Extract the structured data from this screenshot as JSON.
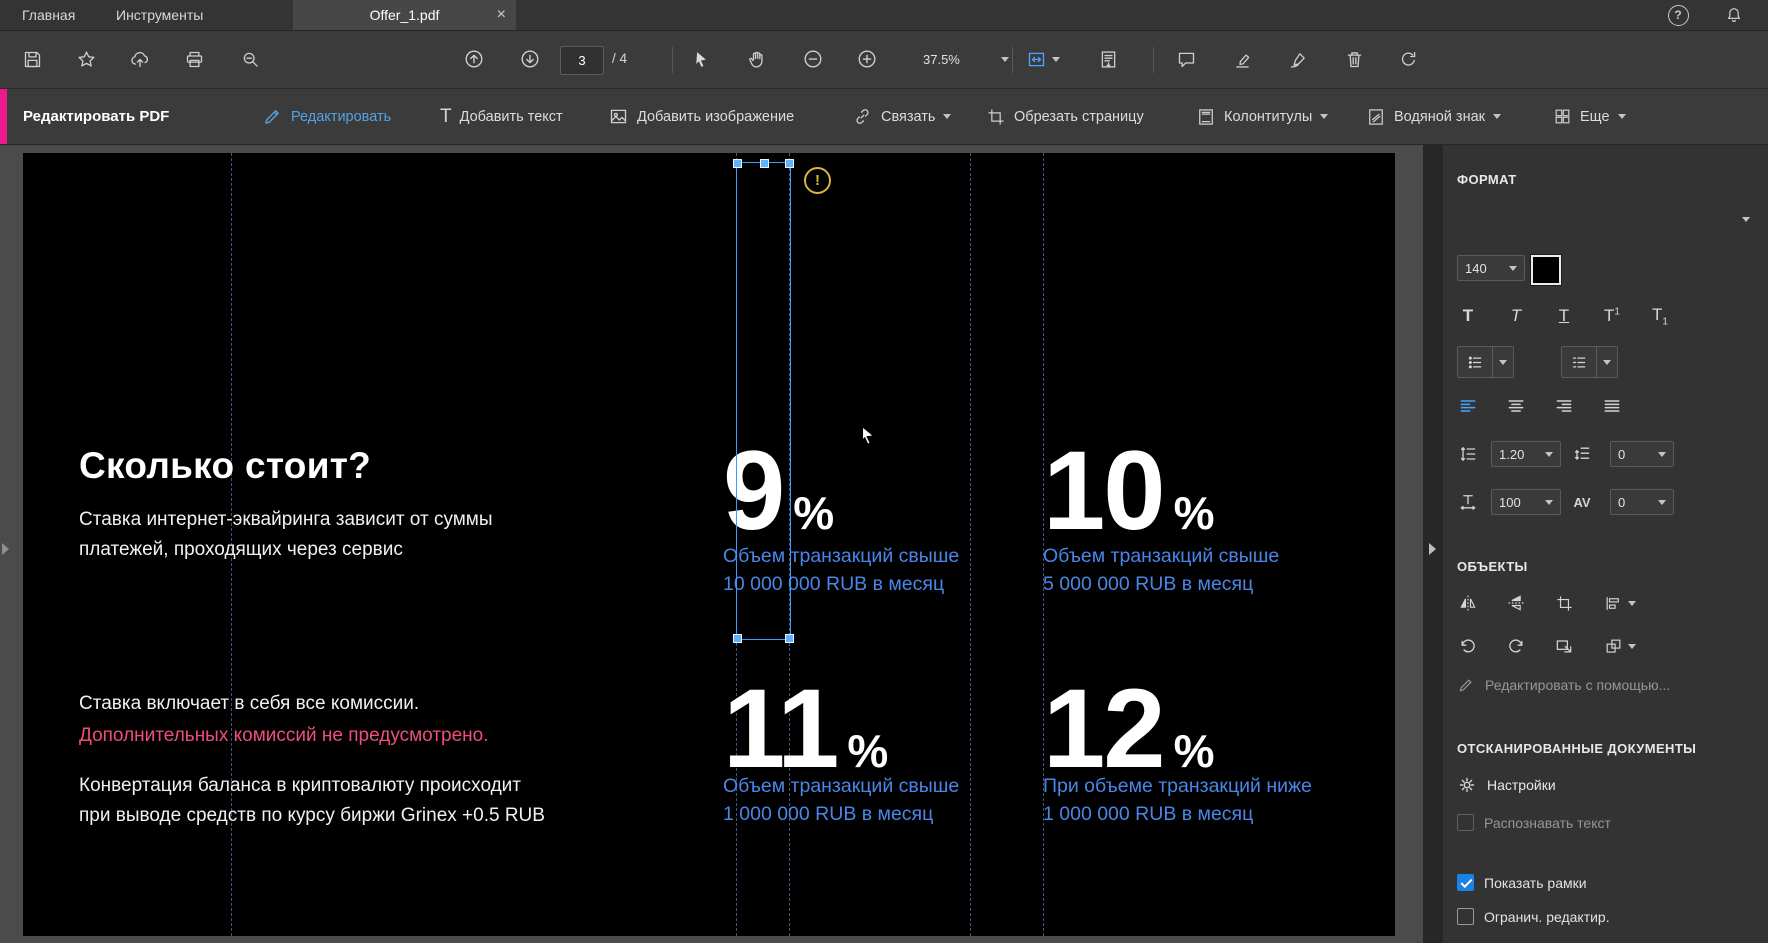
{
  "titlebar": {
    "home_tab": "Главная",
    "tools_tab": "Инструменты",
    "document_tab": "Offer_1.pdf",
    "close_glyph": "×",
    "help_glyph": "?"
  },
  "toolbar": {
    "page_current": "3",
    "page_total": "/ 4",
    "zoom_value": "37.5%"
  },
  "editbar": {
    "title": "Редактировать PDF",
    "edit": "Редактировать",
    "text_tool_glyph": "T",
    "add_text": "Добавить текст",
    "add_image": "Добавить изображение",
    "link": "Связать",
    "crop": "Обрезать страницу",
    "header_footer": "Колонтитулы",
    "watermark": "Водяной знак",
    "more": "Еще"
  },
  "pdf": {
    "heading": "Сколько стоит?",
    "intro_line1": "Ставка интернет-эквайринга зависит от суммы",
    "intro_line2": "платежей, проходящих через сервис",
    "fees_line1": "Ставка включает в себя все комиссии.",
    "fees_line2": "Дополнительных комиссий не предусмотрено.",
    "conversion_line1": "Конвертация баланса в криптовалюту происходит",
    "conversion_line2": "при выводе средств по курсу биржи Grinex +0.5 RUB",
    "warning_glyph": "!",
    "tiers": [
      {
        "rate": "9",
        "unit": "%",
        "caption_line1": "Объем транзакций свыше",
        "caption_line2": "10 000 000 RUB в месяц"
      },
      {
        "rate": "10",
        "unit": "%",
        "caption_line1": "Объем транзакций свыше",
        "caption_line2": "5 000 000 RUB в месяц"
      },
      {
        "rate": "11",
        "unit": "%",
        "caption_line1": "Объем транзакций свыше",
        "caption_line2": "1 000 000 RUB в месяц"
      },
      {
        "rate": "12",
        "unit": "%",
        "caption_line1": "При объеме транзакций ниже",
        "caption_line2": "1 000 000 RUB в месяц"
      }
    ]
  },
  "panel": {
    "format_title": "ФОРМАТ",
    "font_size_value": "140",
    "glyphs": {
      "bold": "T",
      "italic": "T",
      "underline": "T",
      "sup_base": "T",
      "sup_mark": "1",
      "sub_base": "T",
      "sub_mark": "1",
      "hscale": "T",
      "kerning": "AV"
    },
    "line_spacing_value": "1.20",
    "para_spacing_value": "0",
    "h_scale_value": "100",
    "char_spacing_value": "0",
    "objects_title": "ОБЪЕКТЫ",
    "edit_using": "Редактировать с помощью...",
    "scanned_title": "ОТСКАНИРОВАННЫЕ ДОКУМЕНТЫ",
    "settings": "Настройки",
    "recognize_text": "Распознавать текст",
    "show_frames": "Показать рамки",
    "restrict_edit": "Огранич. редактир."
  },
  "colors": {
    "accent_pink": "#ed1a8b",
    "active_blue": "#55a1e6",
    "pdf_link_blue": "#4a86e8",
    "pdf_pink": "#ee4f78",
    "selection_blue": "#3a9bfd",
    "checkbox_blue": "#1a82e2"
  }
}
